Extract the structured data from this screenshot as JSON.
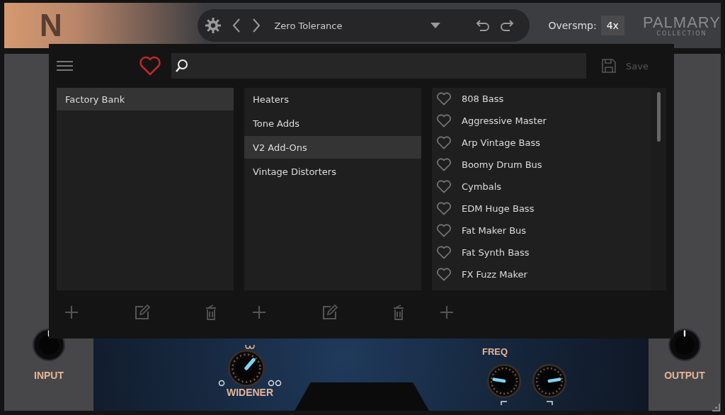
{
  "header": {
    "logo": "N",
    "preset_name": "Zero Tolerance",
    "oversampling_label": "Oversmp:",
    "oversampling_value": "4x",
    "brand": "PALMARY",
    "brand_sub": "COLLECTION"
  },
  "browser": {
    "save_label": "Save",
    "save_disabled": true,
    "banks": [
      {
        "label": "Factory Bank",
        "selected": true
      }
    ],
    "categories": [
      {
        "label": "Heaters",
        "selected": false
      },
      {
        "label": "Tone Adds",
        "selected": false
      },
      {
        "label": "V2 Add-Ons",
        "selected": true
      },
      {
        "label": "Vintage Distorters",
        "selected": false
      }
    ],
    "presets": [
      {
        "label": "808 Bass",
        "favorite": false
      },
      {
        "label": "Aggressive Master",
        "favorite": false
      },
      {
        "label": "Arp Vintage Bass",
        "favorite": false
      },
      {
        "label": "Boomy Drum Bus",
        "favorite": false
      },
      {
        "label": "Cymbals",
        "favorite": false
      },
      {
        "label": "EDM Huge Bass",
        "favorite": false
      },
      {
        "label": "Fat Maker Bus",
        "favorite": false
      },
      {
        "label": "Fat Synth Bass",
        "favorite": false
      },
      {
        "label": "FX Fuzz Maker",
        "favorite": false
      }
    ]
  },
  "knobs": {
    "input": {
      "label": "INPUT"
    },
    "widener": {
      "label": "WIDENER"
    },
    "freq_label": "FREQ",
    "output": {
      "label": "OUTPUT"
    }
  }
}
